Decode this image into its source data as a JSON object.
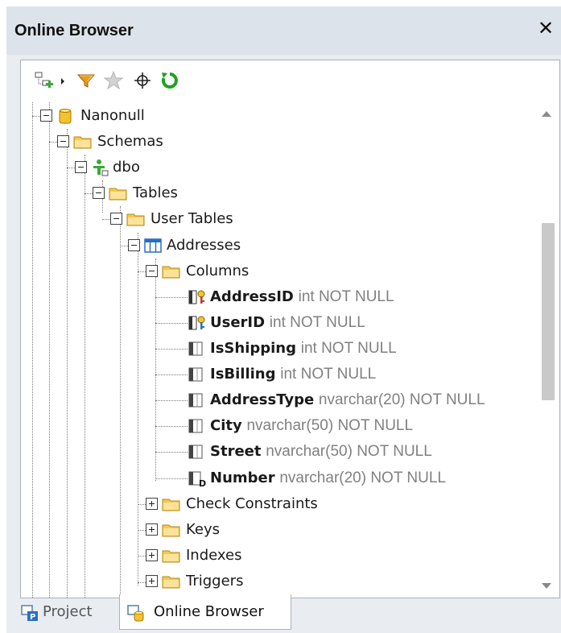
{
  "window": {
    "title": "Online Browser",
    "close_icon": "close-icon"
  },
  "toolbar": {
    "buttons": [
      {
        "name": "add-object-button",
        "icon": "add-object-icon"
      },
      {
        "name": "dropdown-arrow-button",
        "icon": "chevron-right-icon"
      },
      {
        "name": "filter-button",
        "icon": "filter-icon"
      },
      {
        "name": "favorites-button",
        "icon": "star-icon"
      },
      {
        "name": "locate-button",
        "icon": "crosshair-icon"
      },
      {
        "name": "refresh-button",
        "icon": "refresh-icon"
      }
    ]
  },
  "tree": {
    "nodes": [
      {
        "label": "Nanonull",
        "icon": "database-icon",
        "expanded": true
      },
      {
        "label": "Schemas",
        "icon": "folder-icon",
        "expanded": true
      },
      {
        "label": "dbo",
        "icon": "schema-user-icon",
        "expanded": true
      },
      {
        "label": "Tables",
        "icon": "folder-icon",
        "expanded": true
      },
      {
        "label": "User Tables",
        "icon": "folder-icon",
        "expanded": true
      },
      {
        "label": "Addresses",
        "icon": "table-icon",
        "expanded": true
      },
      {
        "label": "Columns",
        "icon": "folder-icon",
        "expanded": true
      },
      {
        "name": "AddressID",
        "type": "int NOT NULL",
        "icon": "primary-key-column-icon"
      },
      {
        "name": "UserID",
        "type": "int NOT NULL",
        "icon": "primary-key-column-icon"
      },
      {
        "name": "IsShipping",
        "type": "int NOT NULL",
        "icon": "column-icon"
      },
      {
        "name": "IsBilling",
        "type": "int NOT NULL",
        "icon": "column-icon"
      },
      {
        "name": "AddressType",
        "type": "nvarchar(20) NOT NULL",
        "icon": "column-icon"
      },
      {
        "name": "City",
        "type": "nvarchar(50) NOT NULL",
        "icon": "column-icon"
      },
      {
        "name": "Street",
        "type": "nvarchar(50) NOT NULL",
        "icon": "column-icon"
      },
      {
        "name": "Number",
        "type": "nvarchar(20) NOT NULL",
        "icon": "default-column-icon"
      },
      {
        "label": "Check Constraints",
        "icon": "folder-icon",
        "expanded": false
      },
      {
        "label": "Keys",
        "icon": "folder-icon",
        "expanded": false
      },
      {
        "label": "Indexes",
        "icon": "folder-icon",
        "expanded": false
      },
      {
        "label": "Triggers",
        "icon": "folder-icon",
        "expanded": false
      }
    ]
  },
  "tabs": [
    {
      "label": "Project",
      "icon": "project-icon",
      "active": false
    },
    {
      "label": "Online Browser",
      "icon": "online-browser-icon",
      "active": true
    }
  ],
  "colors": {
    "titlebar": "#dde3ea",
    "folder": "#f5c94a",
    "database": "#f2c230",
    "filter": "#e89c1a",
    "refresh": "#21a121",
    "type_text": "#808080",
    "table_blue": "#2a6ebf"
  }
}
